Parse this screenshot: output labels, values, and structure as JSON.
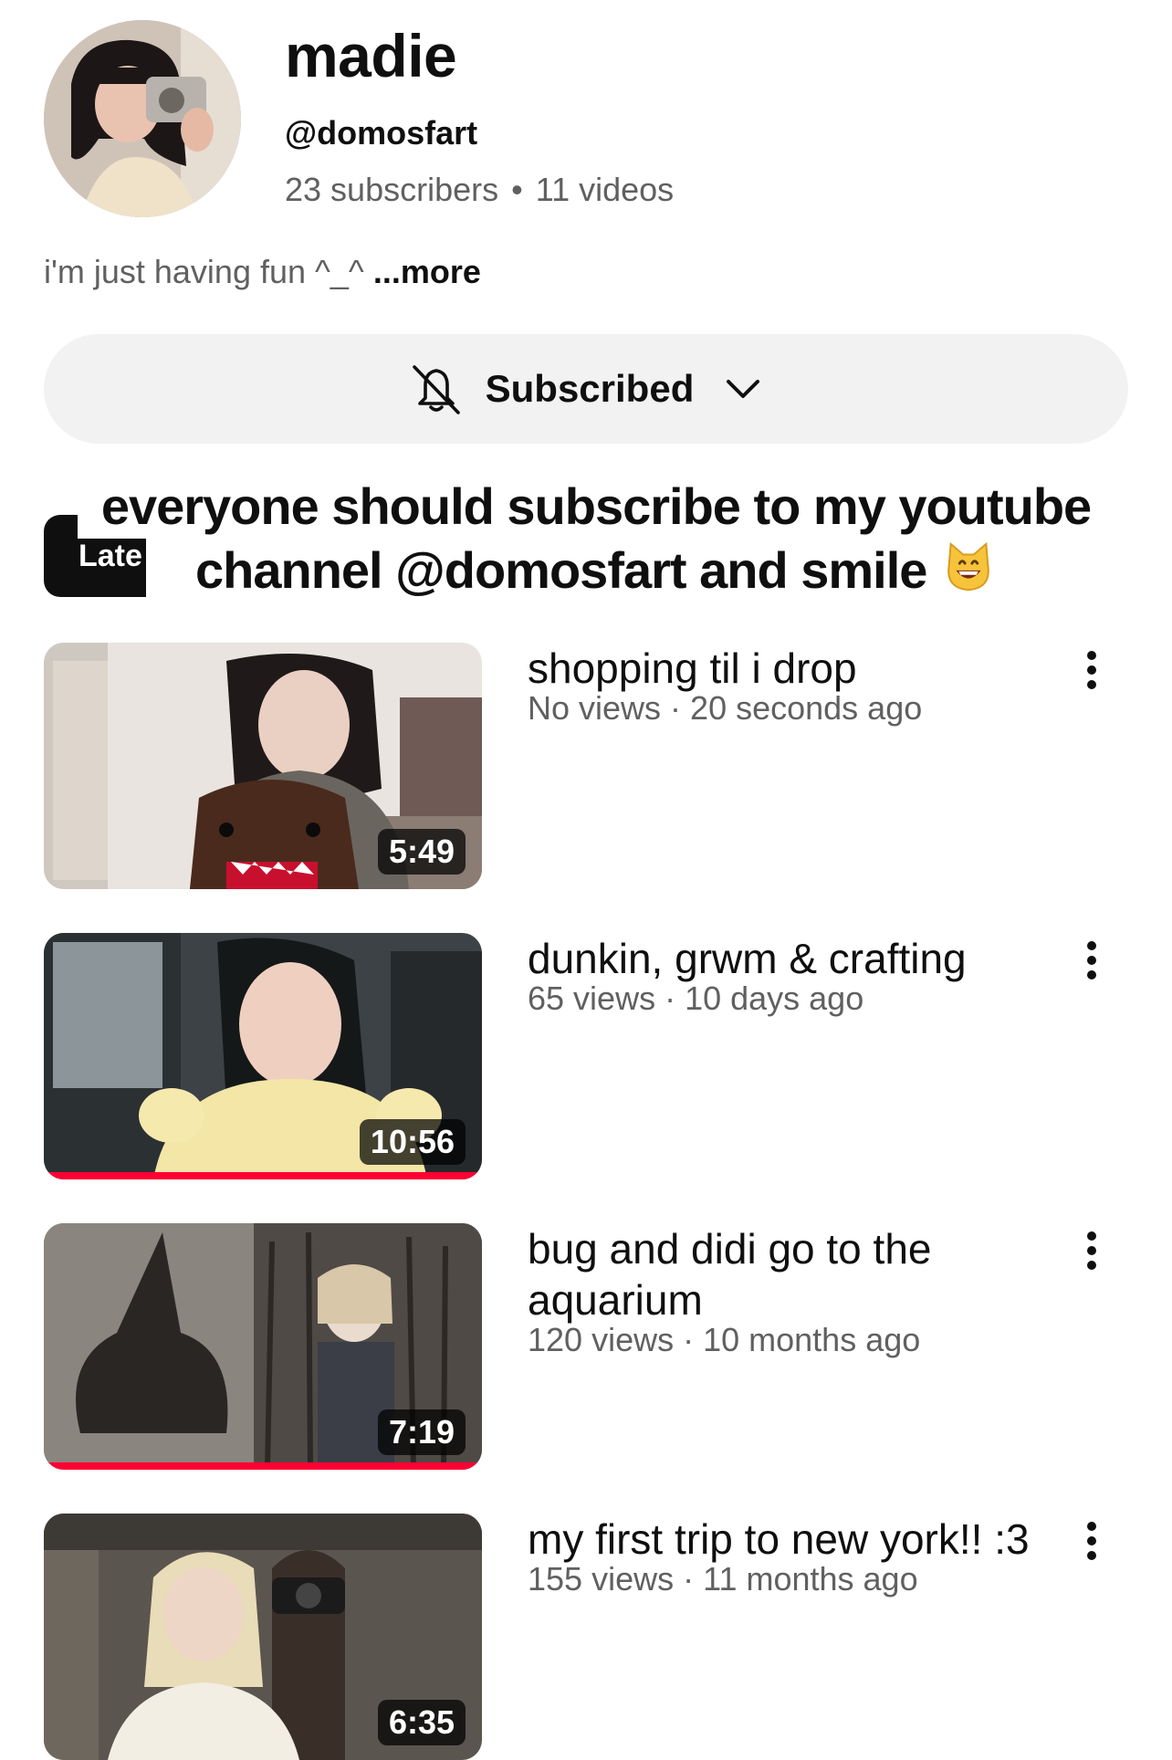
{
  "channel": {
    "name": "madie",
    "handle": "@domosfart",
    "subscribers": "23 subscribers",
    "videos": "11 videos",
    "separator": "•",
    "bio": "i'm just having fun ^_^",
    "more_label": "...more",
    "avatar_icon": "channel-avatar-photo"
  },
  "subscribe": {
    "label": "Subscribed",
    "bell_icon": "bell-off-icon",
    "chevron_icon": "chevron-down-icon"
  },
  "tabs": {
    "active_partial_label": "Late"
  },
  "overlay_caption": {
    "line1": "everyone should subscribe to my youtube",
    "line2": "channel @domosfart and smile",
    "emoji": "grinning-cat-emoji"
  },
  "videos": [
    {
      "title": "shopping til i drop",
      "views": "No views",
      "age": "20 seconds ago",
      "duration": "5:49",
      "watched_fraction": 0
    },
    {
      "title": "dunkin, grwm & crafting",
      "views": "65 views",
      "age": "10 days ago",
      "duration": "10:56",
      "watched_fraction": 1
    },
    {
      "title": "bug and didi go to the aquarium",
      "views": "120 views",
      "age": "10 months ago",
      "duration": "7:19",
      "watched_fraction": 1
    },
    {
      "title": "my first trip to new york!! :3",
      "views": "155 views",
      "age": "11 months ago",
      "duration": "6:35",
      "watched_fraction": 0
    }
  ],
  "meta_separator": "·",
  "colors": {
    "progress": "#ff0033",
    "secondary_text": "#606060",
    "button_bg": "#f2f2f2"
  }
}
